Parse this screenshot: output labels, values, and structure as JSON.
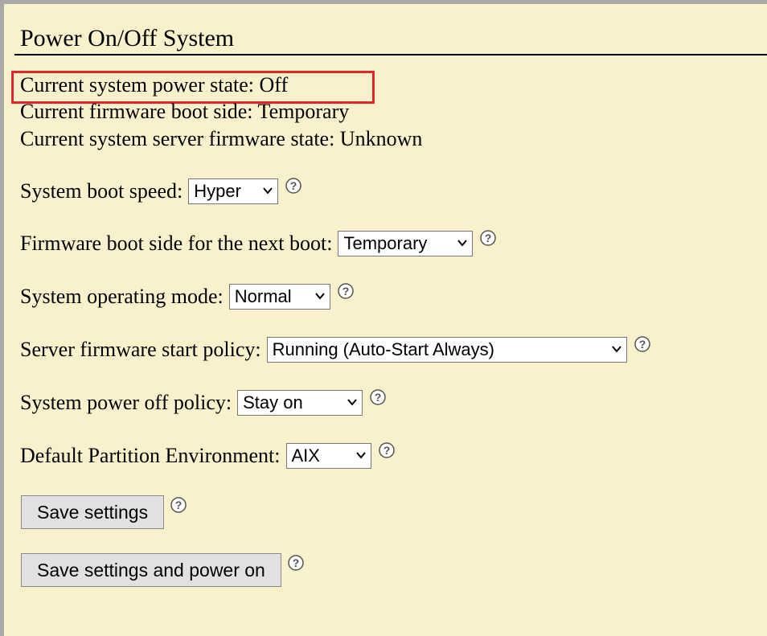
{
  "page": {
    "title": "Power On/Off System"
  },
  "status": {
    "power_state": "Current system power state: Off",
    "boot_side": "Current firmware boot side: Temporary",
    "firmware_state": "Current system server firmware state: Unknown"
  },
  "settings": {
    "boot_speed": {
      "label": "System boot speed:",
      "value": "Hyper"
    },
    "next_boot_side": {
      "label": "Firmware boot side for the next boot:",
      "value": "Temporary"
    },
    "operating_mode": {
      "label": "System operating mode:",
      "value": "Normal"
    },
    "start_policy": {
      "label": "Server firmware start policy:",
      "value": "Running (Auto-Start Always)"
    },
    "power_off_policy": {
      "label": "System power off policy:",
      "value": "Stay on"
    },
    "partition_env": {
      "label": "Default Partition Environment:",
      "value": "AIX"
    }
  },
  "actions": {
    "save": "Save settings",
    "save_power_on": "Save settings and power on"
  },
  "colors": {
    "background": "#f8f1cc",
    "highlight_border": "#e0262b"
  },
  "icons": {
    "help": "question-circle-icon",
    "dropdown": "chevron-down-icon"
  }
}
